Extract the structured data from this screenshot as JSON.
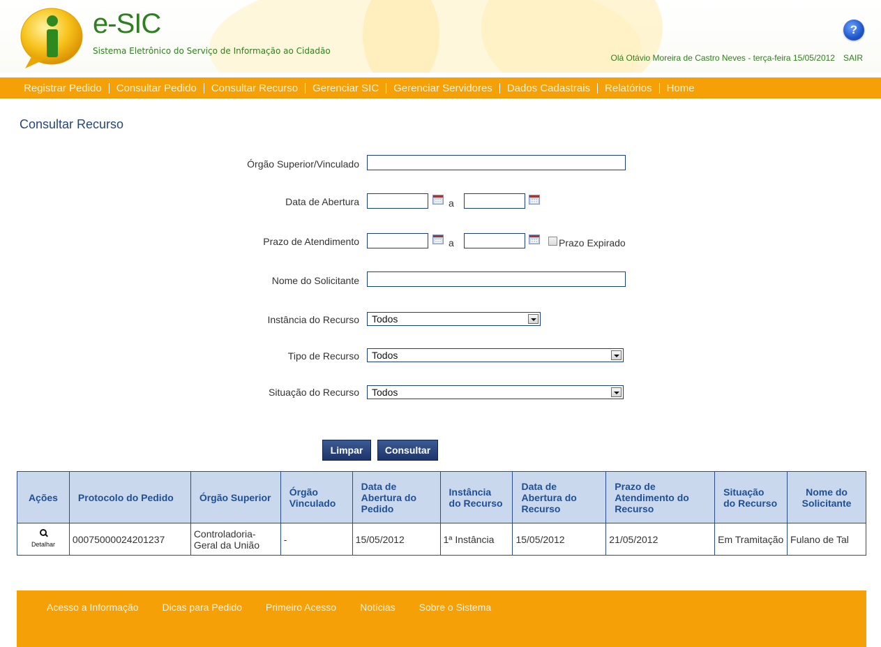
{
  "header": {
    "brand_name": "e-SIC",
    "brand_tagline": "Sistema Eletrônico do Serviço de Informação ao Cidadão",
    "greeting": "Olá Otávio Moreira de Castro Neves - terça-feira 15/05/2012",
    "logout_label": "SAIR",
    "help_label": "?"
  },
  "nav": {
    "items": [
      "Registrar Pedido",
      "Consultar Pedido",
      "Consultar Recurso",
      "Gerenciar SIC",
      "Gerenciar Servidores",
      "Dados Cadastrais",
      "Relatórios",
      "Home"
    ]
  },
  "page_title": "Consultar Recurso",
  "form": {
    "orgao_label": "Órgão Superior/Vinculado",
    "orgao_value": "",
    "data_abertura_label": "Data de Abertura",
    "data_abertura_from": "",
    "data_abertura_to": "",
    "prazo_label": "Prazo de Atendimento",
    "prazo_from": "",
    "prazo_to": "",
    "range_sep": "a",
    "prazo_expirado_label": "Prazo Expirado",
    "prazo_expirado_checked": false,
    "nome_label": "Nome do Solicitante",
    "nome_value": "",
    "instancia_label": "Instância do Recurso",
    "instancia_value": "Todos",
    "tipo_label": "Tipo de Recurso",
    "tipo_value": "Todos",
    "situacao_label": "Situação do Recurso",
    "situacao_value": "Todos",
    "clear_button": "Limpar",
    "search_button": "Consultar"
  },
  "table": {
    "headers": [
      "Ações",
      "Protocolo do Pedido",
      "Órgão Superior",
      "Órgão Vinculado",
      "Data de Abertura do Pedido",
      "Instância do Recurso",
      "Data de Abertura do Recurso",
      "Prazo de Atendimento do Recurso",
      "Situação do Recurso",
      "Nome do Solicitante"
    ],
    "rows": [
      {
        "action": "Detalhar",
        "protocolo": "00075000024201237",
        "orgao_superior": "Controladoria-Geral da União",
        "orgao_vinculado": "-",
        "data_abertura_pedido": "15/05/2012",
        "instancia": "1ª Instância",
        "data_abertura_recurso": "15/05/2012",
        "prazo": "21/05/2012",
        "situacao": "Em Tramitação",
        "nome": "Fulano de Tal"
      }
    ]
  },
  "footer": {
    "links": [
      "Acesso a Informação",
      "Dicas para Pedido",
      "Primeiro Acesso",
      "Notícias",
      "Sobre o Sistema"
    ]
  },
  "colors": {
    "nav_orange": "#f5a007",
    "brand_green": "#2e7f1e",
    "title_blue": "#27467a",
    "table_header_bg": "#c9d8ec",
    "button_blue": "#1c356a"
  }
}
